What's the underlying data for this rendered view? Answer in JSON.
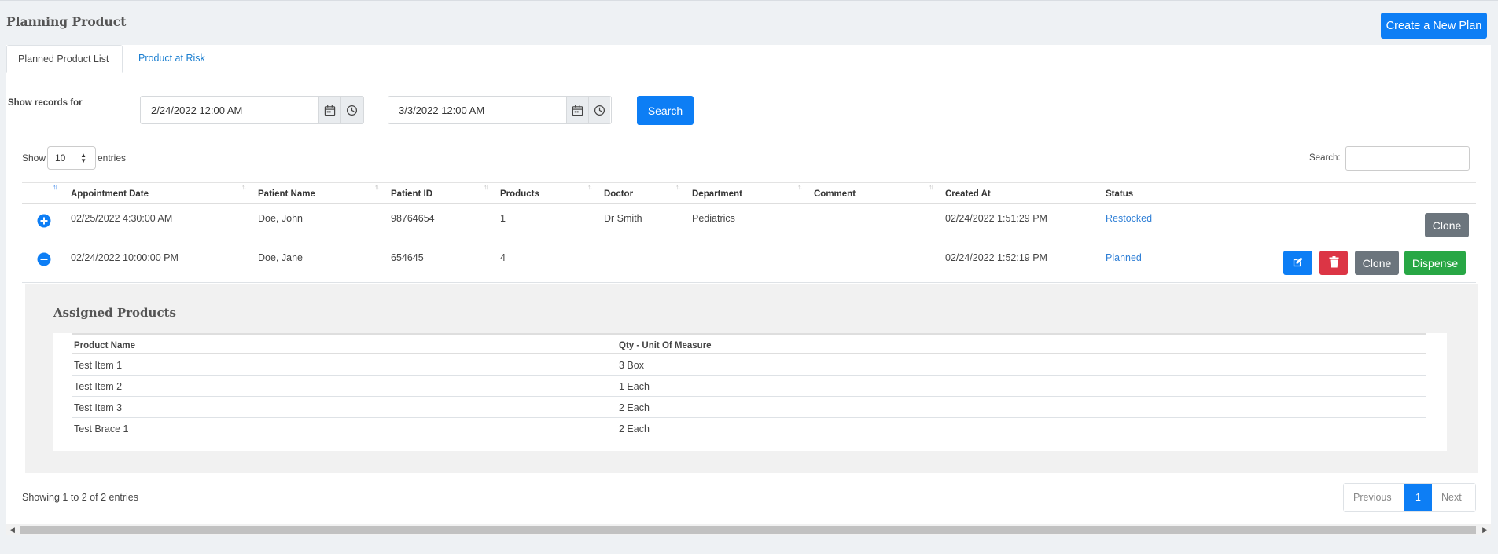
{
  "page": {
    "title": "Planning Product",
    "create_button": "Create a New Plan"
  },
  "tabs": [
    {
      "label": "Planned Product List",
      "active": true
    },
    {
      "label": "Product at Risk",
      "active": false
    }
  ],
  "filters": {
    "show_records_label": "Show records for",
    "start_date": "2/24/2022 12:00 AM",
    "end_date": "3/3/2022 12:00 AM",
    "search_button": "Search"
  },
  "table_controls": {
    "show_label": "Show",
    "page_length": "10",
    "entries_label": "entries",
    "search_label": "Search:",
    "search_value": ""
  },
  "table": {
    "columns": [
      "Appointment Date",
      "Patient Name",
      "Patient ID",
      "Products",
      "Doctor",
      "Department",
      "Comment",
      "Created At",
      "Status"
    ],
    "rows": [
      {
        "expanded": false,
        "appointment_date": "02/25/2022 4:30:00 AM",
        "patient_name": "Doe, John",
        "patient_id": "98764654",
        "products": "1",
        "doctor": "Dr Smith",
        "department": "Pediatrics",
        "comment": "",
        "created_at": "02/24/2022 1:51:29 PM",
        "status": "Restocked",
        "actions": [
          "Clone"
        ]
      },
      {
        "expanded": true,
        "appointment_date": "02/24/2022 10:00:00 PM",
        "patient_name": "Doe, Jane",
        "patient_id": "654645",
        "products": "4",
        "doctor": "",
        "department": "",
        "comment": "",
        "created_at": "02/24/2022 1:52:19 PM",
        "status": "Planned",
        "actions": [
          "Clone",
          "Dispense"
        ]
      }
    ]
  },
  "assigned_products": {
    "title": "Assigned Products",
    "columns": [
      "Product Name",
      "Qty - Unit Of Measure"
    ],
    "rows": [
      {
        "name": "Test Item 1",
        "qty": "3 Box"
      },
      {
        "name": "Test Item 2",
        "qty": "1 Each"
      },
      {
        "name": "Test Item 3",
        "qty": "2 Each"
      },
      {
        "name": "Test Brace 1",
        "qty": "2 Each"
      }
    ]
  },
  "footer": {
    "info": "Showing 1 to 2 of 2 entries",
    "previous": "Previous",
    "current_page": "1",
    "next": "Next"
  },
  "colors": {
    "primary": "#0d7ef5",
    "danger": "#dc3545",
    "success": "#28a745",
    "secondary": "#6c757d",
    "status_link": "#2f7fd6"
  }
}
